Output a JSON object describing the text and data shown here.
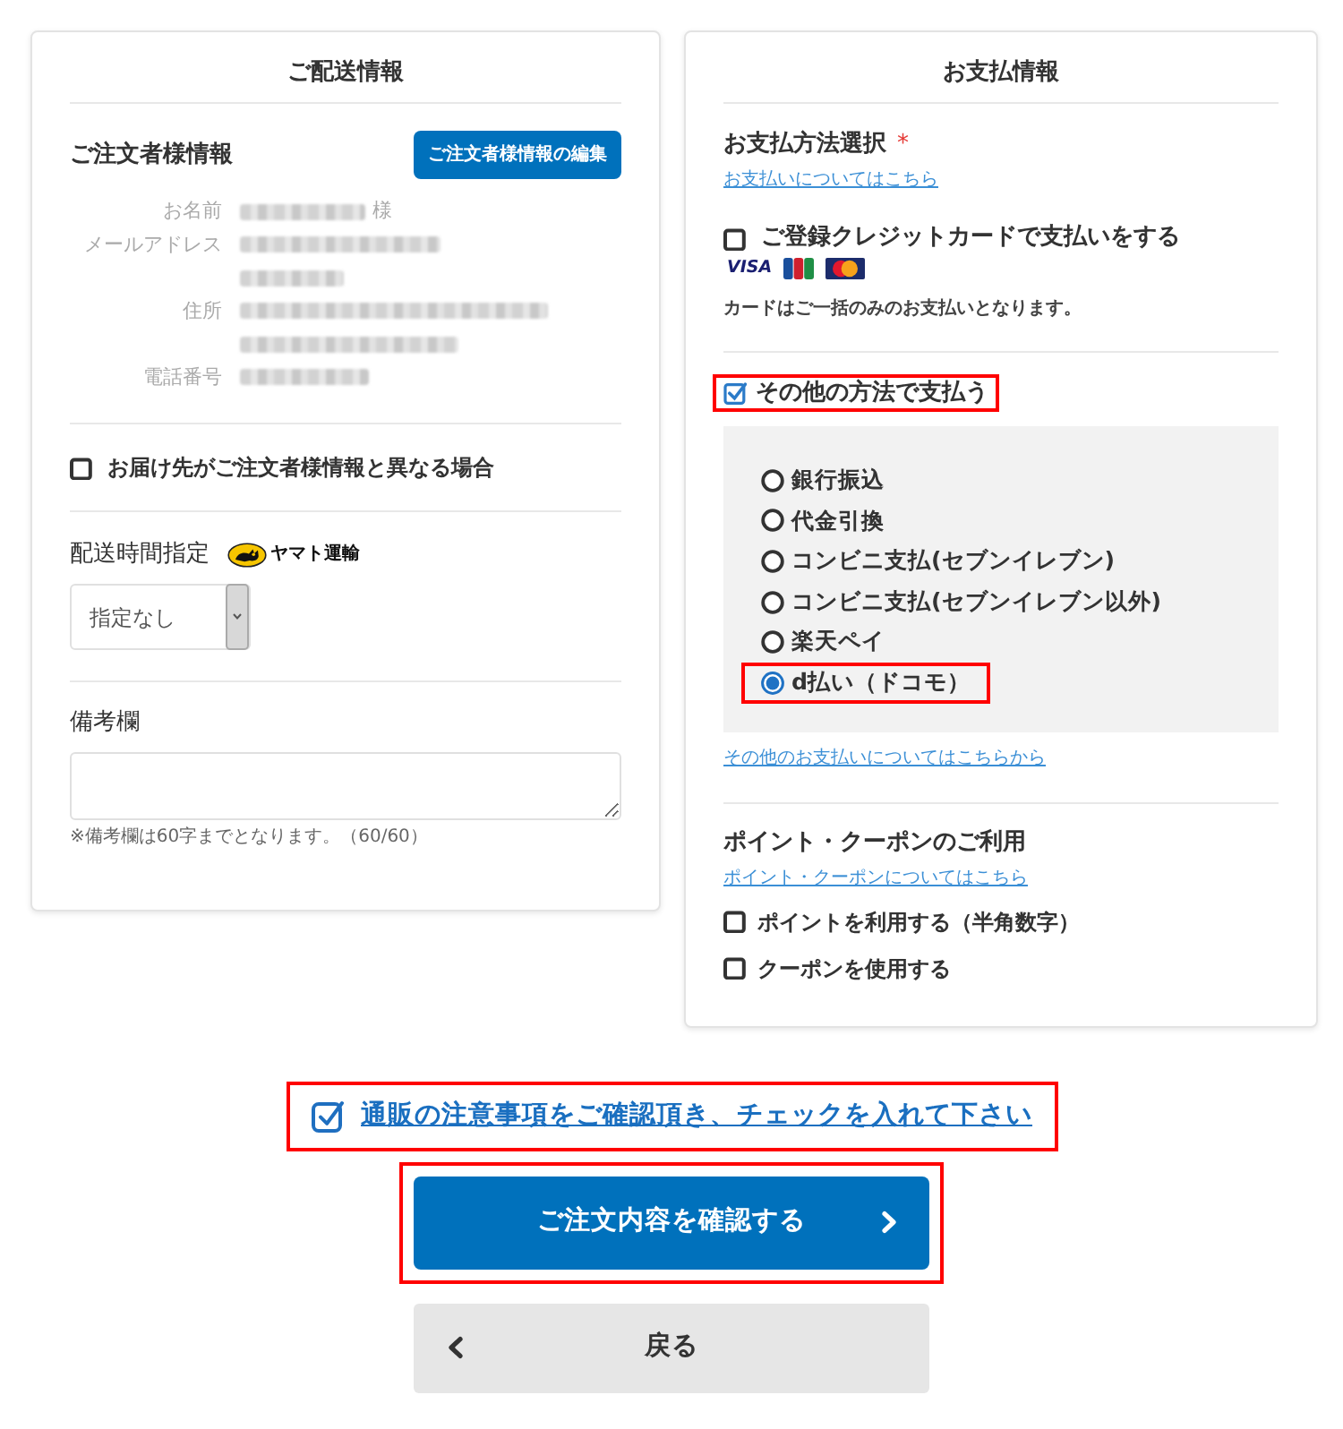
{
  "shipping": {
    "title": "ご配送情報",
    "orderer": {
      "heading": "ご注文者様情報",
      "edit_button": "ご注文者様情報の編集",
      "fields": [
        {
          "label": "お名前",
          "suffix": "様"
        },
        {
          "label": "メールアドレス"
        },
        {
          "label": "住所"
        },
        {
          "label": "電話番号"
        }
      ]
    },
    "different_address": {
      "label": "お届け先がご注文者様情報と異なる場合",
      "checked": false
    },
    "delivery_time": {
      "label": "配送時間指定",
      "carrier_text": "ヤマト運輸",
      "value": "指定なし"
    },
    "remarks": {
      "label": "備考欄",
      "note": "※備考欄は60字までとなります。（60/60）"
    }
  },
  "payment": {
    "title": "お支払情報",
    "method": {
      "label": "お支払方法選択",
      "required_mark": "*",
      "link": "お支払いについてはこちら"
    },
    "saved_card": {
      "label": "ご登録クレジットカードで支払いをする",
      "checked": false,
      "brands": [
        {
          "kind": "visa",
          "text": "VISA"
        },
        {
          "kind": "jcb"
        },
        {
          "kind": "mastercard"
        }
      ],
      "note": "カードはご一括のみのお支払いとなります。"
    },
    "other_method": {
      "label": "その他の方法で支払う",
      "checked": true,
      "highlighted": true,
      "options": [
        {
          "label": "銀行振込",
          "selected": false,
          "highlighted": false
        },
        {
          "label": "代金引換",
          "selected": false,
          "highlighted": false
        },
        {
          "label": "コンビニ支払(セブンイレブン)",
          "selected": false,
          "highlighted": false
        },
        {
          "label": "コンビニ支払(セブンイレブン以外)",
          "selected": false,
          "highlighted": false
        },
        {
          "label": "楽天ペイ",
          "selected": false,
          "highlighted": false
        },
        {
          "label": "d払い（ドコモ）",
          "selected": true,
          "highlighted": true
        }
      ],
      "link": "その他のお支払いについてはこちらから"
    },
    "points": {
      "heading": "ポイント・クーポンのご利用",
      "link": "ポイント・クーポンについてはこちら",
      "options": [
        {
          "label": "ポイントを利用する（半角数字）",
          "checked": false
        },
        {
          "label": "クーポンを使用する",
          "checked": false
        }
      ]
    }
  },
  "agreement": {
    "label": "通販の注意事項をご確認頂き、チェックを入れて下さい",
    "checked": true,
    "highlighted": true
  },
  "buttons": [
    {
      "kind": "confirm",
      "label": "ご注文内容を確認する",
      "highlighted": true
    },
    {
      "kind": "back",
      "label": "戻る",
      "highlighted": false
    }
  ]
}
